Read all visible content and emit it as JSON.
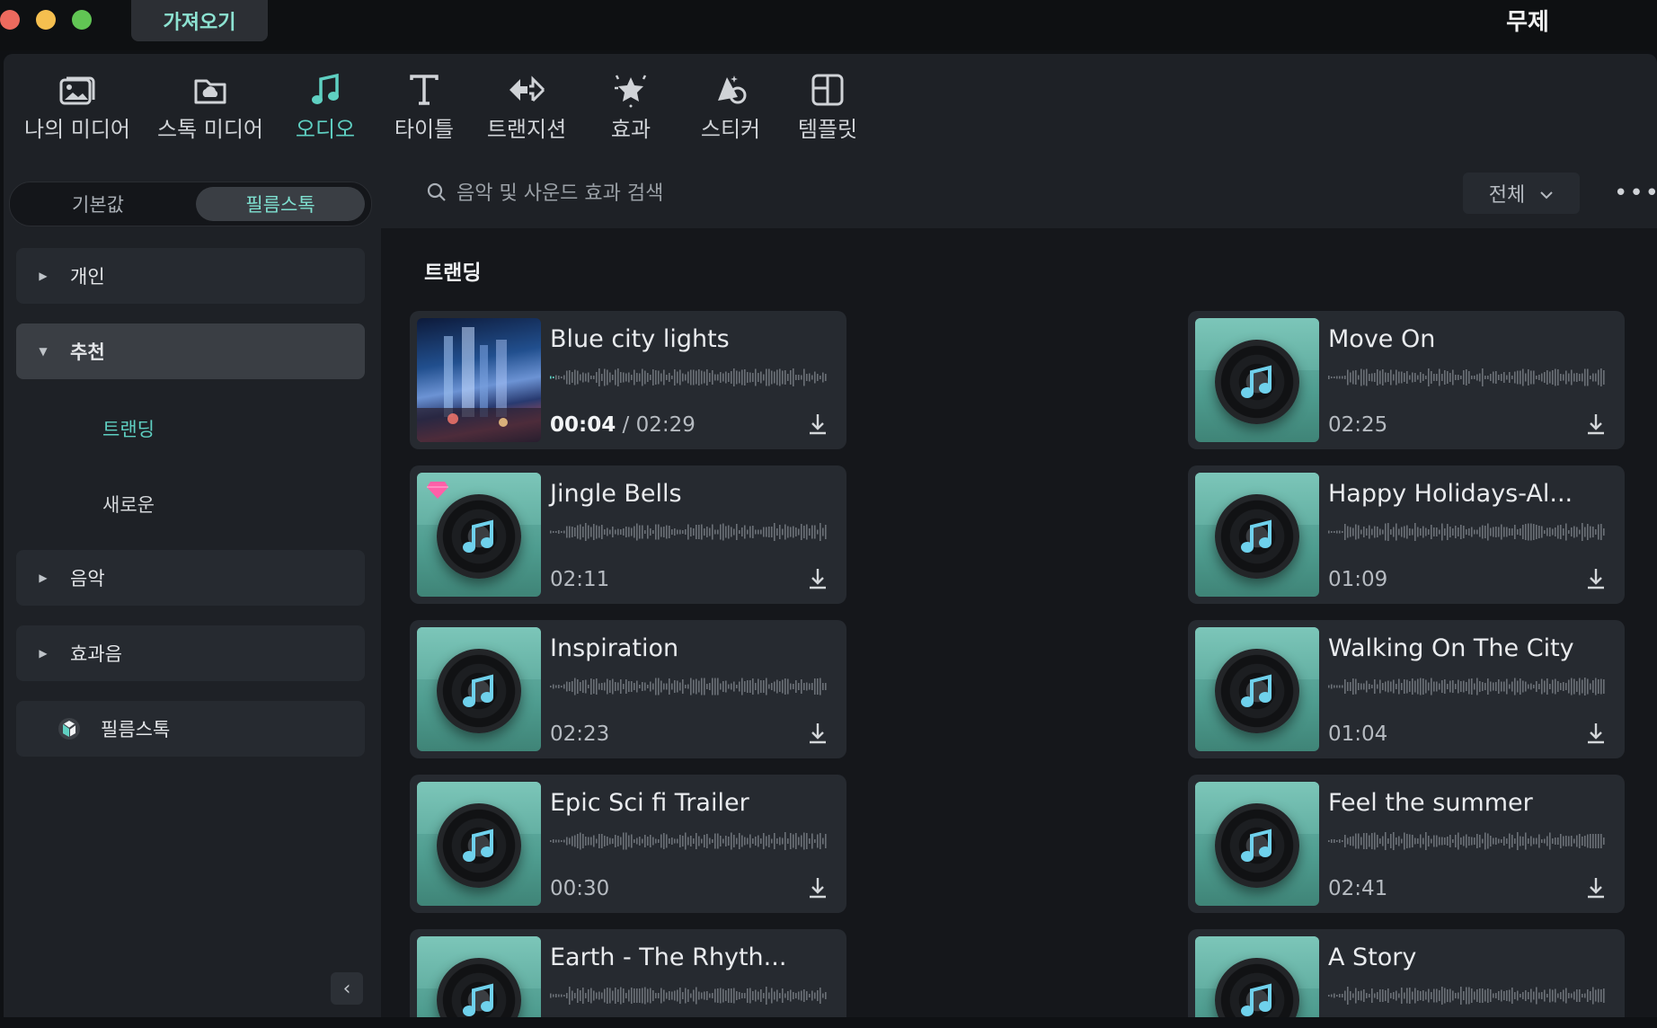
{
  "window": {
    "import_label": "가져오기",
    "title": "무제",
    "traffic_colors": [
      "#ed6a5e",
      "#f5bf4f",
      "#61c554"
    ]
  },
  "toolbar": {
    "items": [
      {
        "label": "나의 미디어",
        "icon": "my-media-icon"
      },
      {
        "label": "스톡 미디어",
        "icon": "stock-media-icon"
      },
      {
        "label": "오디오",
        "icon": "music-note-icon",
        "active": true
      },
      {
        "label": "타이틀",
        "icon": "title-text-icon"
      },
      {
        "label": "트랜지션",
        "icon": "transition-icon"
      },
      {
        "label": "효과",
        "icon": "effects-icon"
      },
      {
        "label": "스티커",
        "icon": "sticker-icon"
      },
      {
        "label": "템플릿",
        "icon": "template-icon"
      }
    ],
    "accent": "#5fd0c2"
  },
  "sidebar": {
    "segments": [
      "기본값",
      "필름스톡"
    ],
    "active_segment": "필름스톡",
    "categories": [
      {
        "label": "개인",
        "expanded": false
      },
      {
        "label": "추천",
        "expanded": true,
        "children": [
          "트랜딩",
          "새로운"
        ],
        "active_child": "트랜딩"
      },
      {
        "label": "음악",
        "expanded": false
      },
      {
        "label": "효과음",
        "expanded": false
      },
      {
        "label": "필름스톡",
        "icon": "filmstock-logo-icon"
      }
    ]
  },
  "search": {
    "placeholder": "음악 및 사운드 효과 검색",
    "filter": "전체"
  },
  "section": {
    "title": "트랜딩"
  },
  "tracks_left": [
    {
      "title": "Blue city lights",
      "elapsed": "00:04",
      "duration": "02:29",
      "playing": true,
      "thumb": "city"
    },
    {
      "title": "Jingle Bells",
      "duration": "02:11",
      "premium": true
    },
    {
      "title": "Inspiration",
      "duration": "02:23"
    },
    {
      "title": "Epic Sci fi Trailer",
      "duration": "00:30"
    },
    {
      "title": "Earth - The Rhyth...",
      "duration": ""
    }
  ],
  "tracks_right": [
    {
      "title": "Move On",
      "duration": "02:25"
    },
    {
      "title": "Happy Holidays-Al...",
      "duration": "01:09"
    },
    {
      "title": "Walking On The City",
      "duration": "01:04"
    },
    {
      "title": "Feel the summer",
      "duration": "02:41"
    },
    {
      "title": "A Story",
      "duration": ""
    }
  ]
}
